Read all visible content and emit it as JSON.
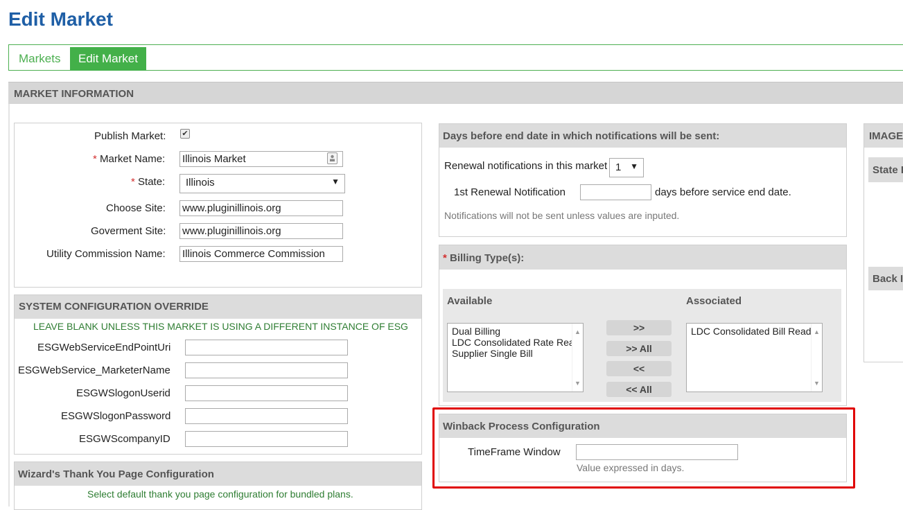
{
  "page": {
    "title": "Edit Market"
  },
  "tabs": [
    {
      "label": "Markets"
    },
    {
      "label": "Edit Market"
    }
  ],
  "section": {
    "title": "MARKET INFORMATION"
  },
  "market_form": {
    "publish": {
      "label": "Publish Market:",
      "checked": true
    },
    "name": {
      "required_mark": "*",
      "label": "Market Name:",
      "value": "Illinois Market"
    },
    "state": {
      "required_mark": "*",
      "label": "State:",
      "value": "Illinois"
    },
    "choose_site": {
      "label": "Choose Site:",
      "value": "www.pluginillinois.org"
    },
    "government_site": {
      "label": "Goverment Site:",
      "value": "www.pluginillinois.org"
    },
    "utility_commission": {
      "label": "Utility Commission Name:",
      "value": "Illinois Commerce Commission"
    }
  },
  "system_config": {
    "title": "SYSTEM CONFIGURATION OVERRIDE",
    "note": "LEAVE BLANK UNLESS THIS MARKET IS USING A DIFFERENT INSTANCE OF ESG",
    "fields": [
      {
        "label": "ESGWebServiceEndPointUri",
        "value": ""
      },
      {
        "label": "ESGWebService_MarketerName",
        "value": ""
      },
      {
        "label": "ESGWSlogonUserid",
        "value": ""
      },
      {
        "label": "ESGWSlogonPassword",
        "value": ""
      },
      {
        "label": "ESGWScompanyID",
        "value": ""
      }
    ]
  },
  "wizard": {
    "title": "Wizard's Thank You Page Configuration",
    "note": "Select default thank you page configuration for bundled plans."
  },
  "notifications": {
    "title": "Days before end date in which notifications will be sent:",
    "renewal_label": "Renewal notifications in this market",
    "renewal_count": "1",
    "first_label": "1st Renewal Notification",
    "first_value": "",
    "first_suffix": "days before service end date.",
    "note": "Notifications will not be sent unless values are inputed."
  },
  "billing": {
    "required_mark": "*",
    "title": "Billing Type(s):",
    "available_label": "Available",
    "associated_label": "Associated",
    "available": [
      "Dual Billing",
      "LDC Consolidated Rate Rea",
      "Supplier Single Bill"
    ],
    "associated": [
      "LDC Consolidated Bill Read"
    ],
    "buttons": {
      "add": ">>",
      "add_all": ">> All",
      "remove": "<<",
      "remove_all": "<< All"
    }
  },
  "winback": {
    "title": "Winback Process Configuration",
    "label": "TimeFrame Window",
    "value": "",
    "hint": "Value expressed in days.",
    "highlight_color": "#e00000"
  },
  "right_panel": {
    "title": "IMAGE",
    "state_label": "State I",
    "back_label": "Back I"
  },
  "colors": {
    "title_blue": "#1f5fa6",
    "tab_green": "#43b049",
    "required_red": "#d32f2f",
    "note_green": "#2e7d32"
  }
}
